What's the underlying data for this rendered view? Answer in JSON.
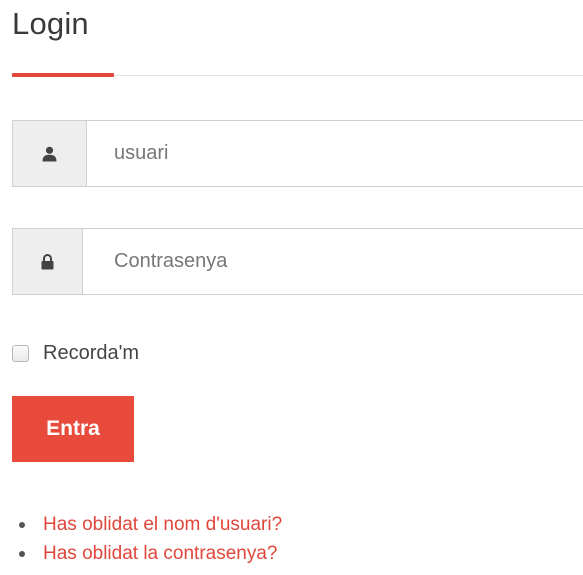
{
  "header": {
    "title": "Login"
  },
  "form": {
    "username": {
      "icon": "user-icon",
      "placeholder": "usuari",
      "value": ""
    },
    "password": {
      "icon": "lock-icon",
      "placeholder": "Contrasenya",
      "value": ""
    },
    "remember": {
      "label": "Recorda'm",
      "checked": false
    },
    "submit_label": "Entra"
  },
  "links": [
    {
      "label": "Has oblidat el nom d'usuari?"
    },
    {
      "label": "Has oblidat la contrasenya?"
    }
  ],
  "colors": {
    "accent": "#e84a3b",
    "link": "#e0463a",
    "addon_bg": "#eeeeee",
    "border": "#cfcfcf"
  }
}
